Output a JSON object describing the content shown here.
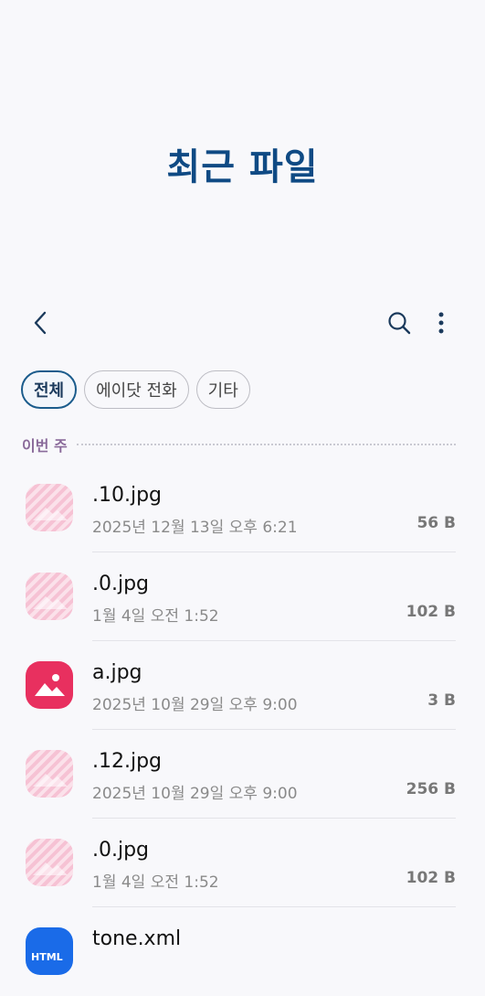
{
  "header": {
    "title": "최근 파일"
  },
  "toolbar": {
    "back_icon": "chevron-left-icon",
    "search_icon": "search-icon",
    "more_icon": "more-vertical-icon"
  },
  "filters": [
    {
      "label": "전체",
      "active": true
    },
    {
      "label": "에이닷 전화",
      "active": false
    },
    {
      "label": "기타",
      "active": false
    }
  ],
  "section": {
    "label": "이번 주"
  },
  "files": [
    {
      "name": ".10.jpg",
      "date": "2025년 12월 13일 오후 6:21",
      "size": "56 B",
      "icon": "image-faded-icon"
    },
    {
      "name": ".0.jpg",
      "date": "1월 4일 오전 1:52",
      "size": "102 B",
      "icon": "image-faded-icon"
    },
    {
      "name": "a.jpg",
      "date": "2025년 10월 29일 오후 9:00",
      "size": "3 B",
      "icon": "image-icon"
    },
    {
      "name": ".12.jpg",
      "date": "2025년 10월 29일 오후 9:00",
      "size": "256 B",
      "icon": "image-faded-icon"
    },
    {
      "name": ".0.jpg",
      "date": "1월 4일 오전 1:52",
      "size": "102 B",
      "icon": "image-faded-icon"
    },
    {
      "name": "tone.xml",
      "date": "",
      "size": "",
      "icon": "html-file-icon",
      "icon_text": "HTML"
    }
  ],
  "colors": {
    "title": "#0f4a84",
    "active_chip_border": "#1b5c8c",
    "image_icon": "#e8305f",
    "html_icon": "#1a6be8"
  }
}
